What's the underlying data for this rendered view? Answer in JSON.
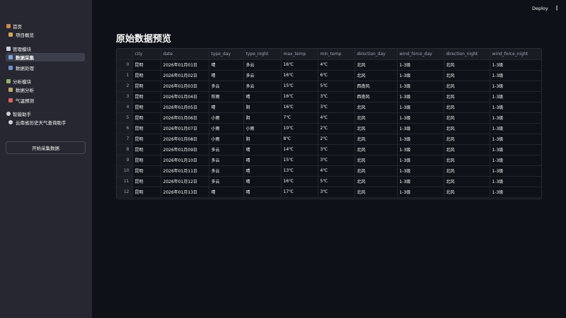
{
  "app": {
    "deploy_label": "Deploy",
    "menu_glyph": "⋮"
  },
  "sidebar": {
    "home": {
      "label": "首页"
    },
    "overview": {
      "label": "项目概览"
    },
    "manage_header": {
      "label": "管理模块"
    },
    "collect": {
      "label": "数据采集"
    },
    "process": {
      "label": "数据处理"
    },
    "analysis_header": {
      "label": "分析模块"
    },
    "analysis": {
      "label": "数据分析"
    },
    "predict": {
      "label": "气温预测"
    },
    "assistant_header": {
      "label": "智能助手"
    },
    "assistant": {
      "label": "云南省历史天气查询助手"
    },
    "collect_button": "开始采集数据"
  },
  "main": {
    "title": "原始数据预览",
    "columns": [
      "",
      "city",
      "date",
      "type_day",
      "type_night",
      "max_temp",
      "min_temp",
      "direction_day",
      "wind_force_day",
      "direction_night",
      "wind_force_night"
    ],
    "rows": [
      [
        "0",
        "昆明",
        "2026年01月01日",
        "晴",
        "多云",
        "16℃",
        "4℃",
        "北风",
        "1-3级",
        "北风",
        "1-3级"
      ],
      [
        "1",
        "昆明",
        "2026年01月02日",
        "晴",
        "多云",
        "16℃",
        "6℃",
        "北风",
        "1-3级",
        "北风",
        "1-3级"
      ],
      [
        "2",
        "昆明",
        "2026年01月03日",
        "多云",
        "多云",
        "15℃",
        "5℃",
        "西南风",
        "1-3级",
        "北风",
        "1-3级"
      ],
      [
        "3",
        "昆明",
        "2026年01月04日",
        "阵雨",
        "晴",
        "16℃",
        "3℃",
        "西南风",
        "1-3级",
        "北风",
        "1-3级"
      ],
      [
        "4",
        "昆明",
        "2026年01月05日",
        "晴",
        "阴",
        "16℃",
        "3℃",
        "北风",
        "1-3级",
        "北风",
        "1-3级"
      ],
      [
        "5",
        "昆明",
        "2026年01月06日",
        "小雨",
        "阴",
        "7℃",
        "4℃",
        "北风",
        "1-3级",
        "北风",
        "1-3级"
      ],
      [
        "6",
        "昆明",
        "2026年01月07日",
        "小雨",
        "小雨",
        "10℃",
        "2℃",
        "北风",
        "1-3级",
        "北风",
        "1-3级"
      ],
      [
        "7",
        "昆明",
        "2026年01月08日",
        "小雨",
        "阴",
        "8℃",
        "2℃",
        "北风",
        "1-3级",
        "北风",
        "1-3级"
      ],
      [
        "8",
        "昆明",
        "2026年01月09日",
        "多云",
        "晴",
        "14℃",
        "3℃",
        "北风",
        "1-3级",
        "北风",
        "1-3级"
      ],
      [
        "9",
        "昆明",
        "2026年01月10日",
        "多云",
        "晴",
        "15℃",
        "3℃",
        "北风",
        "1-3级",
        "北风",
        "1-3级"
      ],
      [
        "10",
        "昆明",
        "2026年01月11日",
        "多云",
        "晴",
        "13℃",
        "4℃",
        "北风",
        "1-3级",
        "北风",
        "1-3级"
      ],
      [
        "11",
        "昆明",
        "2026年01月12日",
        "多云",
        "晴",
        "16℃",
        "5℃",
        "北风",
        "1-3级",
        "北风",
        "1-3级"
      ],
      [
        "12",
        "昆明",
        "2026年01月13日",
        "晴",
        "晴",
        "17℃",
        "3℃",
        "北风",
        "1-3级",
        "北风",
        "1-3级"
      ]
    ]
  },
  "colors": {
    "background": "#0e1117",
    "sidebar": "#262730",
    "active_item": "#3d404a"
  },
  "icons": [
    "house-icon",
    "chart-icon",
    "toolbox-icon",
    "card-index-icon",
    "wrench-icon",
    "bar-chart-icon",
    "search-icon",
    "thermometer-icon",
    "chat-icon",
    "cloud-icon",
    "kebab-menu-icon"
  ]
}
